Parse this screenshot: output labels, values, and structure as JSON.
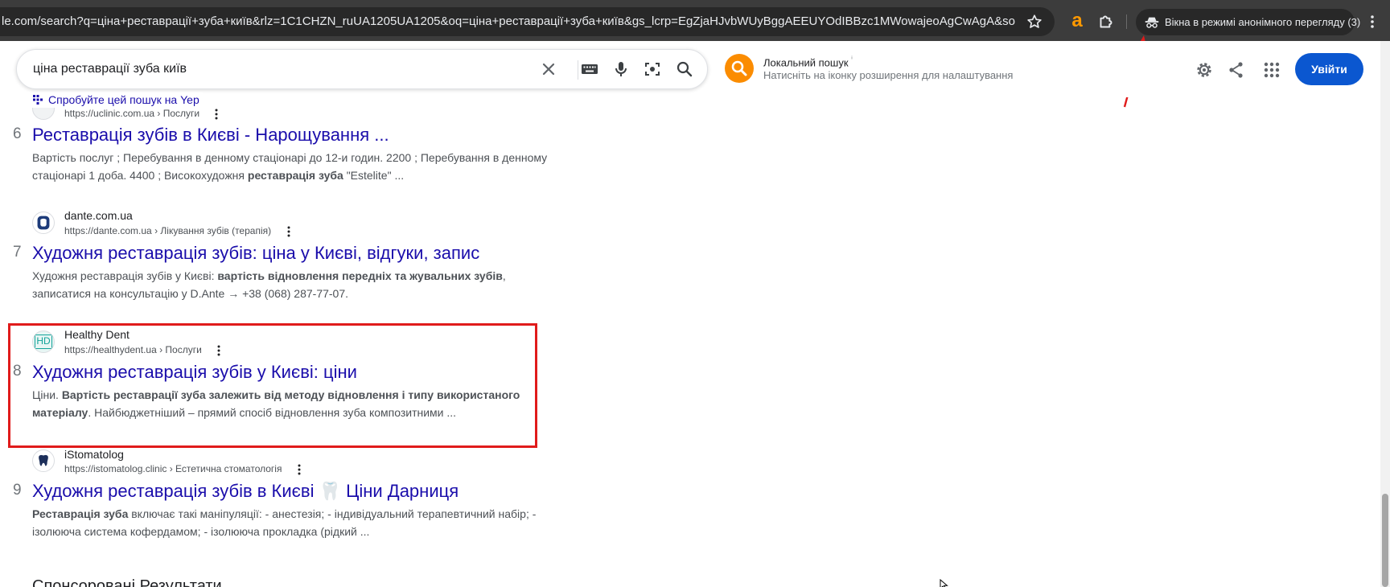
{
  "browser": {
    "url": "le.com/search?q=ціна+реставрації+зуба+київ&rlz=1C1CHZN_ruUA1205UA1205&oq=ціна+реставрації+зуба+київ&gs_lcrp=EgZjaHJvbWUyBggAEEUYOdIBBzc1MWowajeoAgCwAgA&sourceid=chrom...",
    "incognito_label": "Вікна в режимі анонімного перегляду (3)",
    "extension_label": "a"
  },
  "search": {
    "query": "ціна реставрації зуба київ"
  },
  "local_search": {
    "title": "Локальний пошук",
    "info": "ⁱ",
    "subtitle": "Натисніть на іконку розширення для налаштування"
  },
  "header": {
    "signin_label": "Увійти"
  },
  "yep": {
    "label": "Спробуйте цей пошук на Yep"
  },
  "results": [
    {
      "number": "6",
      "url": "https://uclinic.com.ua › Послуги",
      "title": "Реставрація зубів в Києві - Нарощування ...",
      "snippet_line1": "Вартість послуг ; Перебування в денному стаціонарі до 12-и годин. 2200 ; Перебування в денному",
      "snippet_line2_a": "стаціонарі 1 доба. 4400 ; Високохудожня ",
      "snippet_line2_b": "реставрація зуба",
      "snippet_line2_c": " \"Estelite\" ..."
    },
    {
      "number": "7",
      "site_name": "dante.com.ua",
      "url": "https://dante.com.ua › Лікування зубів (терапія)",
      "title": "Художня реставрація зубів: ціна у Києві, відгуки, запис",
      "snippet_line1_a": "Художня реставрація зубів у Києві: ",
      "snippet_line1_b": "вартість відновлення передніх та жувальних зубів",
      "snippet_line1_c": ",",
      "snippet_line2": "записатися на консультацію у D.Ante → +38 (068) 287-77-07."
    },
    {
      "number": "8",
      "site_name": "Healthy Dent",
      "favicon_text": "HD",
      "url": "https://healthydent.ua › Послуги",
      "title": "Художня реставрація зубів у Києві: ціни",
      "snippet_line1_a": "Ціни. ",
      "snippet_line1_b": "Вартість реставрації зуба залежить від методу відновлення і типу використаного",
      "snippet_line2_a": "матеріалу",
      "snippet_line2_b": ". Найбюджетніший – прямий спосіб відновлення зуба композитними ..."
    },
    {
      "number": "9",
      "site_name": "iStomatolog",
      "url": "https://istomatolog.clinic › Естетична стоматологія",
      "title": "Художня реставрація зубів в Києві 🦷 Ціни Дарниця",
      "snippet_line1_a": "Реставрація зуба",
      "snippet_line1_b": " включає такі маніпуляції: - анестезія; - індивідуальний терапевтичний набір; -",
      "snippet_line2": "ізолююча система кофердамом; - ізолююча прокладка (рідкий ..."
    }
  ],
  "sponsored_heading": "Спонсоровані Результати",
  "colors": {
    "link": "#1a0dab",
    "signin": "#0b57d0",
    "annotation": "#e01b1b",
    "chrome_bg": "#3c3c3c"
  }
}
